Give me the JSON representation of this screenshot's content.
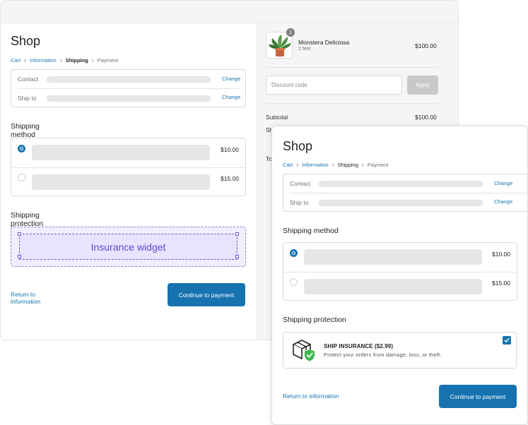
{
  "back": {
    "shop_title": "Shop",
    "breadcrumb": {
      "cart": "Cart",
      "information": "Information",
      "shipping": "Shipping",
      "payment": "Payment",
      "separator": ">"
    },
    "info": {
      "contact_label": "Contact",
      "shipto_label": "Ship to",
      "change_label": "Change"
    },
    "shipping_method_title": "Shipping method",
    "shipping_options": [
      {
        "price": "$10.00",
        "selected": true
      },
      {
        "price": "$15.00",
        "selected": false
      }
    ],
    "shipping_protection_title": "Shipping protection",
    "widget_label": "Insurance widget",
    "return_link": "Return to information",
    "continue_button": "Continue to payment"
  },
  "summary": {
    "product": {
      "name": "Monstera Deliciosa",
      "variant": "2 feet",
      "price": "$100.00",
      "quantity": "1"
    },
    "discount_placeholder": "Discount code",
    "apply_button": "Apply",
    "subtotal_label": "Subtotal",
    "subtotal_value": "$100.00",
    "shipping_label_partial": "Sh",
    "total_label_partial": "To"
  },
  "front": {
    "shop_title": "Shop",
    "breadcrumb": {
      "cart": "Cart",
      "information": "Information",
      "shipping": "Shipping",
      "payment": "Payment",
      "separator": ">"
    },
    "info": {
      "contact_label": "Contact",
      "shipto_label": "Ship to",
      "change_label": "Change"
    },
    "shipping_method_title": "Shipping method",
    "shipping_options": [
      {
        "price": "$10.00",
        "selected": true
      },
      {
        "price": "$15.00",
        "selected": false
      }
    ],
    "shipping_protection_title": "Shipping protection",
    "insurance": {
      "title": "SHIP INSURANCE ($2.99)",
      "description": "Protect your orders from damage, loss, or theft.",
      "checked": true
    },
    "return_link": "Return to information",
    "continue_button": "Continue to payment"
  },
  "colors": {
    "accent": "#1773b0",
    "widget_purple": "#5a4bd0",
    "success_green": "#3fb950"
  },
  "icons": [
    "chevron-right-icon",
    "radio-selected-icon",
    "radio-empty-icon",
    "package-shield-icon",
    "checkmark-icon",
    "plant-thumbnail"
  ]
}
